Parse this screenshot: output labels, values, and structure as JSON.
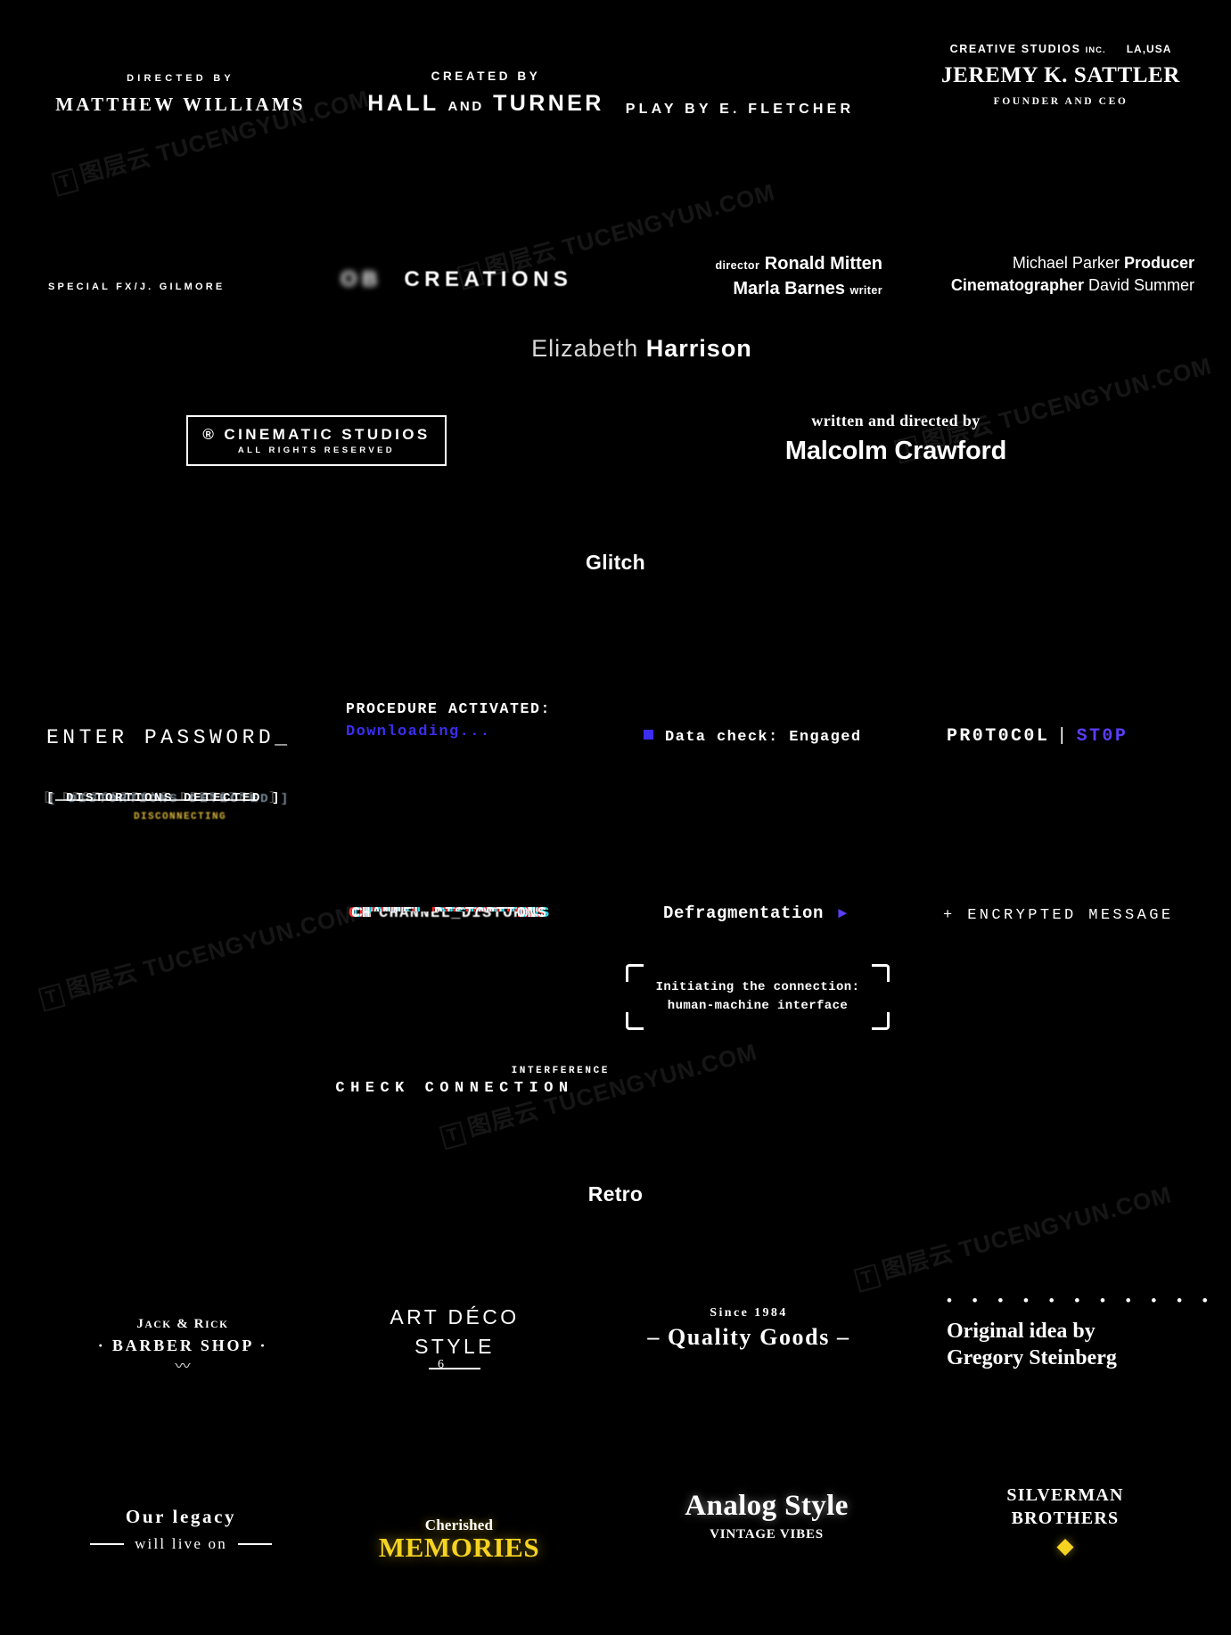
{
  "colors": {
    "background": "#000000",
    "text": "#ffffff",
    "accent_blue": "#3b2ef0",
    "accent_purple": "#5b3df5",
    "accent_yellow": "#f5d321",
    "glitch_red": "#ff2a2a",
    "glitch_cyan": "#22e0f0",
    "warning_amber": "#d8b43a"
  },
  "watermark": {
    "badge": "T",
    "text": "图层云 TUCENGYUN.COM"
  },
  "sections": {
    "cinematic": {
      "credits_row1": [
        {
          "label": "DIRECTED BY",
          "name": "MATTHEW WILLIAMS"
        },
        {
          "label": "CREATED BY",
          "name_a": "HALL",
          "conjunction": "AND",
          "name_b": "TURNER"
        },
        {
          "play_by": "PLAY BY E. FLETCHER"
        }
      ],
      "studio_block": {
        "company": "CREATIVE STUDIOS",
        "company_suffix": "INC.",
        "location": "LA,USA",
        "person": "JEREMY K. SATTLER",
        "role": "FOUNDER AND CEO"
      },
      "special_fx": {
        "label": "SPECIAL FX",
        "separator": "/",
        "name": "J. GILMORE"
      },
      "ob_creations": {
        "part_a": "OB",
        "part_b": "CREATIONS"
      },
      "crew_left": {
        "line1_label": "director",
        "line1_name": "Ronald Mitten",
        "line2_name": "Marla Barnes",
        "line2_label": "writer"
      },
      "crew_right": {
        "line1_name": "Michael Parker",
        "line1_label": "Producer",
        "line2_label": "Cinematographer",
        "line2_name": "David Summer"
      },
      "actor": {
        "first": "Elizabeth",
        "last": "Harrison"
      },
      "box_logo": {
        "mark": "®",
        "title": "CINEMATIC STUDIOS",
        "subtitle": "ALL RIGHTS RESERVED"
      },
      "written_directed": {
        "label_a": "written",
        "label_b": "and",
        "label_c": "directed by",
        "name": "Malcolm Crawford"
      }
    },
    "glitch": {
      "heading": "Glitch",
      "enter_password": "ENTER PASSWORD_",
      "procedure": {
        "title": "PROCEDURE ACTIVATED:",
        "status": "Downloading..."
      },
      "data_check": "Data check: Engaged",
      "protocol": {
        "left": "PR0T0C0L",
        "divider": "|",
        "right": "ST0P"
      },
      "distortions": {
        "text": "[ DISTORTIONS DETECTED ]",
        "sub": "DISCONNECTING"
      },
      "channel_distortions": "CHANNEL_DISTORTIONS",
      "defragmentation": {
        "label": "Defragmentation",
        "arrow": "►"
      },
      "encrypted_message": "+ ENCRYPTED MESSAGE",
      "initiating": {
        "line1": "Initiating the connection:",
        "line2": "human-machine interface"
      },
      "interference": "INTERFERENCE",
      "check_connection": "CHECK CONNECTION"
    },
    "retro": {
      "heading": "Retro",
      "barber": {
        "line1_a": "J",
        "line1_b": "ACK",
        "amp": "&",
        "line1_c": "R",
        "line1_d": "ICK",
        "line2": "· BARBER SHOP ·",
        "swash": "〰"
      },
      "art_deco": {
        "line1": "ART DÉCO",
        "line2": "STYLE"
      },
      "quality": {
        "since": "Since 1984",
        "title": "– Quality Goods –"
      },
      "original_idea": {
        "line1": "Original idea by",
        "line2": "Gregory Steinberg"
      },
      "legacy": {
        "line1": "Our legacy",
        "line2": "will live on"
      },
      "cherished": {
        "line1": "Cherished",
        "line2": "MEMORIES"
      },
      "analog": {
        "title": "Analog Style",
        "subtitle": "VINTAGE VIBES"
      },
      "silverman": {
        "line1": "SILVERMAN",
        "line2": "BROTHERS",
        "ornament": "◆"
      }
    }
  }
}
